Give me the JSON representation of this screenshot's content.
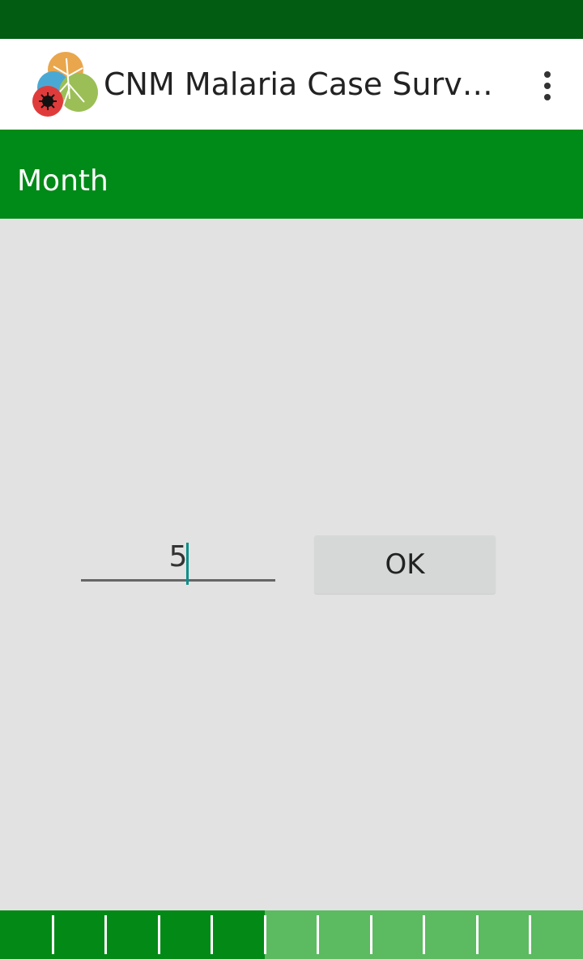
{
  "app": {
    "title": "CNM Malaria Case Surveil...",
    "logo_icon": "malaria-mosquito-logo"
  },
  "header": {
    "title": "Month"
  },
  "form": {
    "value": "5",
    "ok_label": "OK"
  },
  "progress": {
    "completed_steps": 5,
    "total_steps": 11,
    "fill_color": "#038a16",
    "remaining_color": "#5cba61"
  },
  "colors": {
    "status_bar": "#025c12",
    "header": "#008a17",
    "background": "#e2e2e2"
  }
}
